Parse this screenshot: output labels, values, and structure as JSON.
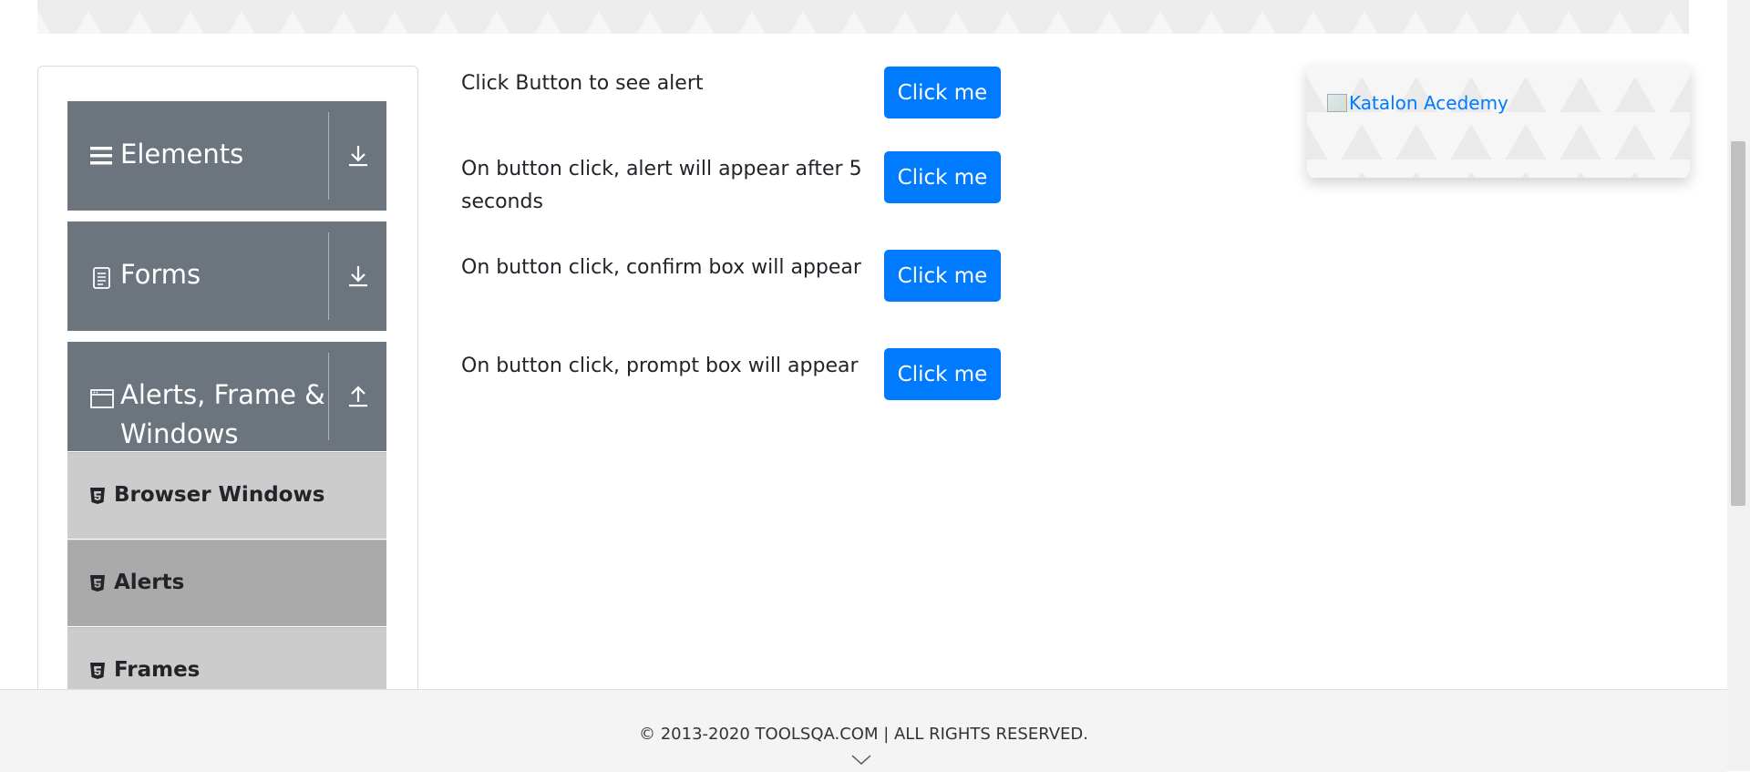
{
  "sidebar": {
    "groups": [
      {
        "label": "Elements",
        "icon": "hamburger-icon",
        "state": "collapsed"
      },
      {
        "label": "Forms",
        "icon": "document-icon",
        "state": "collapsed"
      },
      {
        "label": "Alerts, Frame & Windows",
        "icon": "window-icon",
        "state": "expanded"
      }
    ],
    "items": [
      {
        "label": "Browser Windows",
        "icon": "html5-icon",
        "active": false
      },
      {
        "label": "Alerts",
        "icon": "html5-icon",
        "active": true
      },
      {
        "label": "Frames",
        "icon": "html5-icon",
        "active": false
      }
    ]
  },
  "alerts": {
    "rows": [
      {
        "text": "Click Button to see alert",
        "button": "Click me"
      },
      {
        "text": "On button click, alert will appear after 5 seconds",
        "button": "Click me"
      },
      {
        "text": "On button click, confirm box will appear",
        "button": "Click me"
      },
      {
        "text": "On button click, prompt box will appear",
        "button": "Click me"
      }
    ]
  },
  "ad": {
    "alt_text": "Katalon Acedemy"
  },
  "footer": {
    "copyright": "© 2013-2020 TOOLSQA.COM | ALL RIGHTS RESERVED."
  },
  "colors": {
    "primary": "#007bff",
    "sidebar_header": "#6c757d",
    "menu_item": "#cccccc",
    "menu_item_active": "#aaaaaa"
  }
}
